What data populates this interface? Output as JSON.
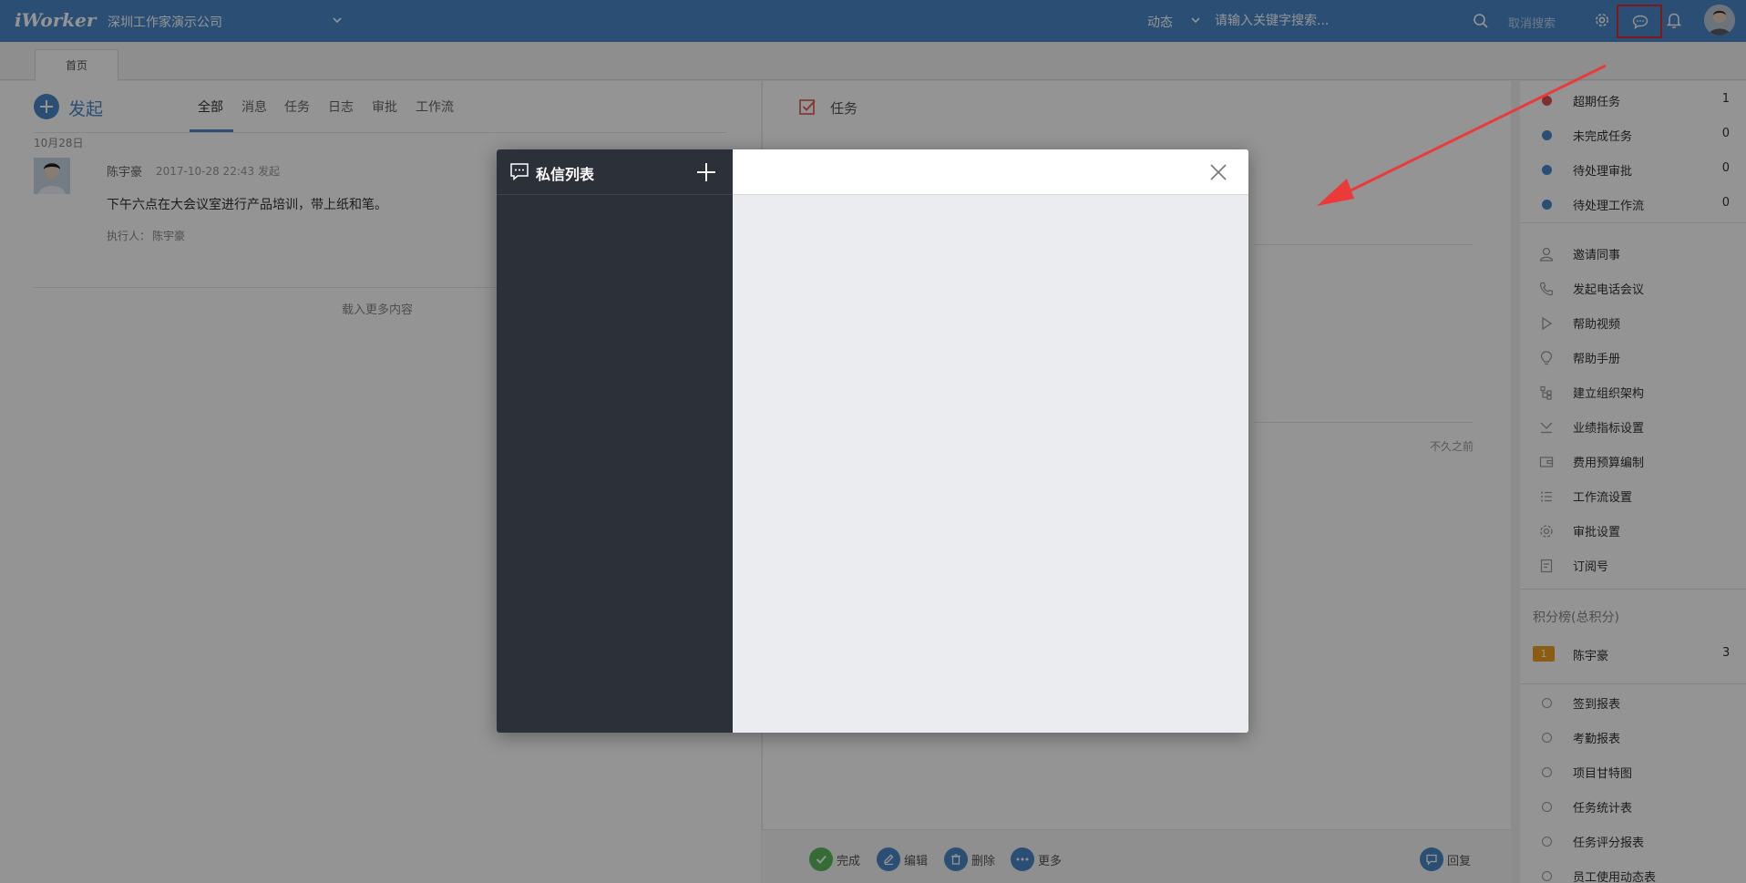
{
  "app": {
    "logo": "iWorker",
    "company": "深圳工作家演示公司"
  },
  "header": {
    "dynamic_label": "动态",
    "search_placeholder": "请输入关键字搜索...",
    "cancel_search": "取消搜索"
  },
  "tabs": {
    "home": "首页"
  },
  "feed": {
    "launch_label": "发起",
    "tabs": [
      "全部",
      "消息",
      "任务",
      "日志",
      "审批",
      "工作流"
    ],
    "date": "10月28日",
    "post": {
      "author": "陈宇豪",
      "time": "2017-10-28 22:43 发起",
      "body": "下午六点在大会议室进行产品培训，带上纸和笔。",
      "executor_label": "执行人：",
      "executor": "陈宇豪"
    },
    "load_more": "载入更多内容"
  },
  "task_panel": {
    "title": "任务",
    "ago": "不久之前",
    "actions": {
      "complete": "完成",
      "edit": "编辑",
      "delete": "删除",
      "more": "更多",
      "reply": "回复"
    }
  },
  "right_sidebar": {
    "status": [
      {
        "label": "超期任务",
        "count": "1",
        "color": "#d9534f"
      },
      {
        "label": "未完成任务",
        "count": "0",
        "color": "#4a89c9"
      },
      {
        "label": "待处理审批",
        "count": "0",
        "color": "#4a89c9"
      },
      {
        "label": "待处理工作流",
        "count": "0",
        "color": "#4a89c9"
      }
    ],
    "tools": [
      {
        "label": "邀请同事",
        "icon": "user-add-icon"
      },
      {
        "label": "发起电话会议",
        "icon": "phone-icon"
      },
      {
        "label": "帮助视频",
        "icon": "play-icon"
      },
      {
        "label": "帮助手册",
        "icon": "bulb-icon"
      },
      {
        "label": "建立组织架构",
        "icon": "org-chart-icon"
      },
      {
        "label": "业绩指标设置",
        "icon": "target-icon"
      },
      {
        "label": "费用预算编制",
        "icon": "wallet-icon"
      },
      {
        "label": "工作流设置",
        "icon": "list-icon"
      },
      {
        "label": "审批设置",
        "icon": "gear-icon"
      },
      {
        "label": "订阅号",
        "icon": "document-icon"
      }
    ],
    "score": {
      "title": "积分榜(总积分)",
      "rank": "1",
      "name": "陈宇豪",
      "value": "3"
    },
    "reports": [
      "签到报表",
      "考勤报表",
      "项目甘特图",
      "任务统计表",
      "任务评分报表",
      "员工使用动态表"
    ]
  },
  "modal": {
    "title": "私信列表"
  },
  "colors": {
    "brand": "#4a89c9",
    "modal_dark": "#2c3039",
    "highlight": "#e02b2b"
  }
}
